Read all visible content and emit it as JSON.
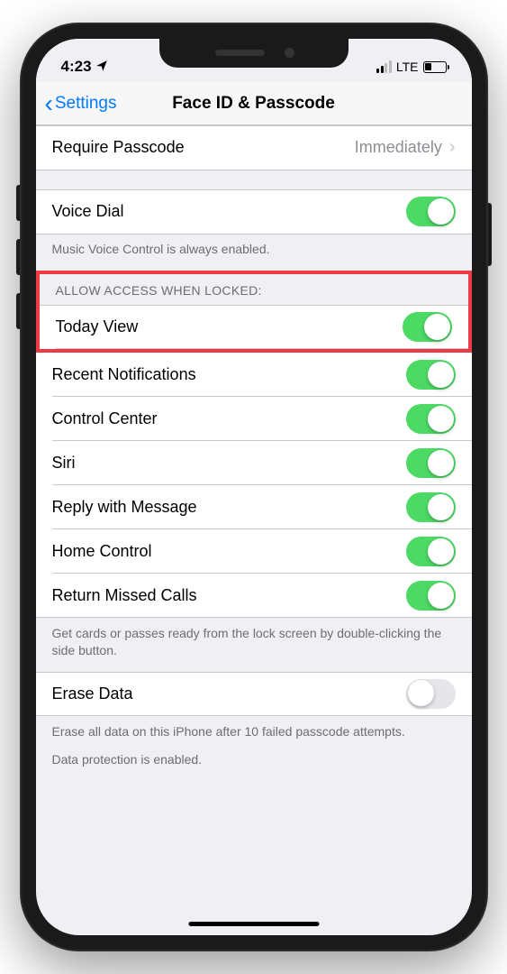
{
  "statusBar": {
    "time": "4:23",
    "network": "LTE"
  },
  "nav": {
    "back": "Settings",
    "title": "Face ID & Passcode"
  },
  "requirePasscode": {
    "label": "Require Passcode",
    "value": "Immediately"
  },
  "voiceDial": {
    "label": "Voice Dial",
    "footer": "Music Voice Control is always enabled."
  },
  "allowAccess": {
    "header": "ALLOW ACCESS WHEN LOCKED:",
    "items": [
      {
        "label": "Today View",
        "on": true
      },
      {
        "label": "Recent Notifications",
        "on": true
      },
      {
        "label": "Control Center",
        "on": true
      },
      {
        "label": "Siri",
        "on": true
      },
      {
        "label": "Reply with Message",
        "on": true
      },
      {
        "label": "Home Control",
        "on": true
      },
      {
        "label": "Return Missed Calls",
        "on": true
      }
    ],
    "footer": "Get cards or passes ready from the lock screen by double-clicking the side button."
  },
  "eraseData": {
    "label": "Erase Data",
    "on": false,
    "footer1": "Erase all data on this iPhone after 10 failed passcode attempts.",
    "footer2": "Data protection is enabled."
  }
}
